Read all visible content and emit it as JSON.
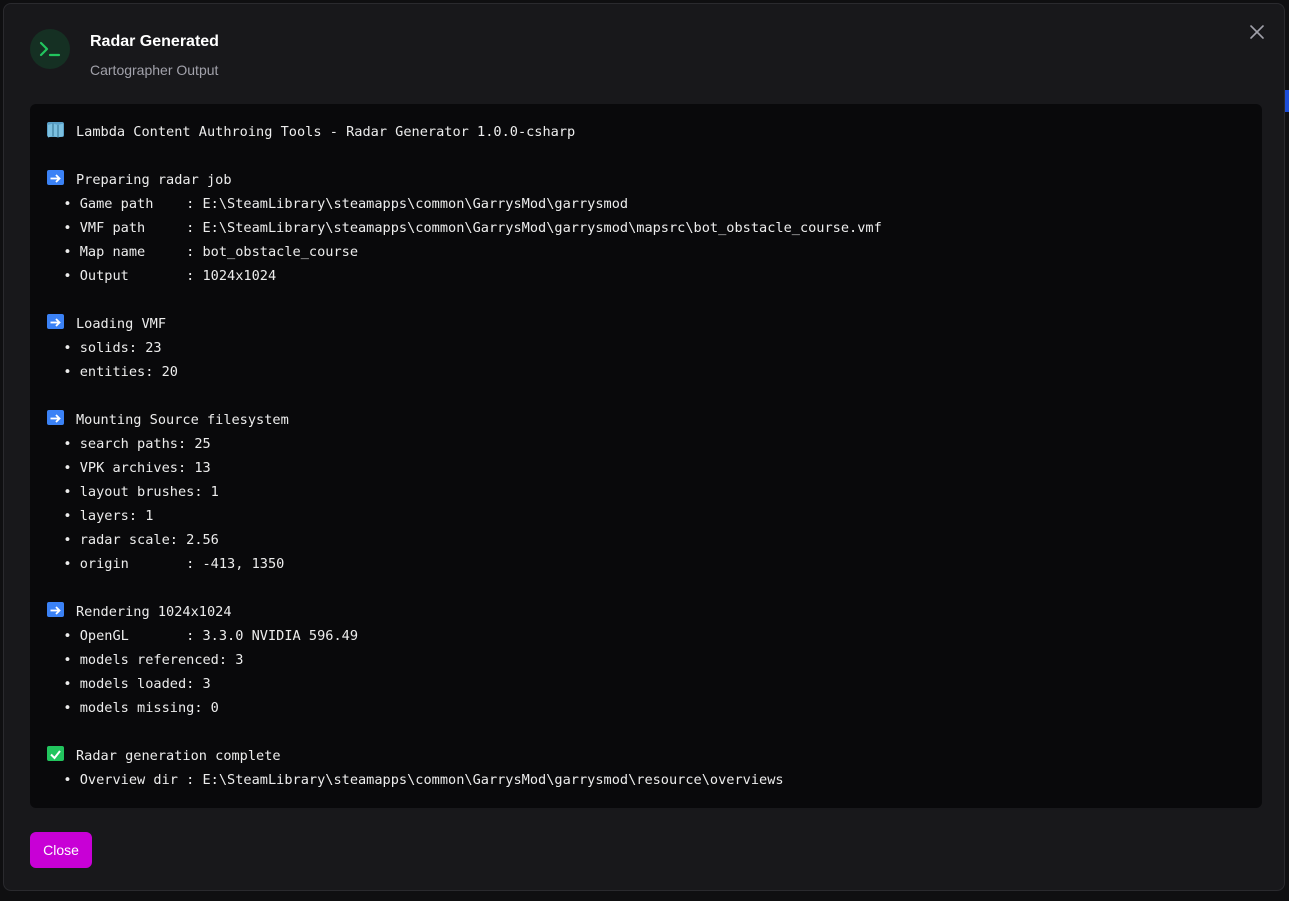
{
  "dialog": {
    "title": "Radar Generated",
    "subtitle": "Cartographer Output",
    "close_label": "Close"
  },
  "colors": {
    "accent": "#c800d6",
    "icon_bg": "#153023",
    "icon_fg": "#22c55e",
    "terminal_bg": "#09090b"
  },
  "output": {
    "lines": [
      {
        "icon": "map-icon",
        "text": "Lambda Content Authroing Tools - Radar Generator 1.0.0-csharp"
      },
      {
        "icon": "",
        "text": ""
      },
      {
        "icon": "arrow-right-icon",
        "text": "Preparing radar job"
      },
      {
        "icon": "",
        "text": "  • Game path    : E:\\SteamLibrary\\steamapps\\common\\GarrysMod\\garrysmod"
      },
      {
        "icon": "",
        "text": "  • VMF path     : E:\\SteamLibrary\\steamapps\\common\\GarrysMod\\garrysmod\\mapsrc\\bot_obstacle_course.vmf"
      },
      {
        "icon": "",
        "text": "  • Map name     : bot_obstacle_course"
      },
      {
        "icon": "",
        "text": "  • Output       : 1024x1024"
      },
      {
        "icon": "",
        "text": ""
      },
      {
        "icon": "arrow-right-icon",
        "text": "Loading VMF"
      },
      {
        "icon": "",
        "text": "  • solids: 23"
      },
      {
        "icon": "",
        "text": "  • entities: 20"
      },
      {
        "icon": "",
        "text": ""
      },
      {
        "icon": "arrow-right-icon",
        "text": "Mounting Source filesystem"
      },
      {
        "icon": "",
        "text": "  • search paths: 25"
      },
      {
        "icon": "",
        "text": "  • VPK archives: 13"
      },
      {
        "icon": "",
        "text": "  • layout brushes: 1"
      },
      {
        "icon": "",
        "text": "  • layers: 1"
      },
      {
        "icon": "",
        "text": "  • radar scale: 2.56"
      },
      {
        "icon": "",
        "text": "  • origin       : -413, 1350"
      },
      {
        "icon": "",
        "text": ""
      },
      {
        "icon": "arrow-right-icon",
        "text": "Rendering 1024x1024"
      },
      {
        "icon": "",
        "text": "  • OpenGL       : 3.3.0 NVIDIA 596.49"
      },
      {
        "icon": "",
        "text": "  • models referenced: 3"
      },
      {
        "icon": "",
        "text": "  • models loaded: 3"
      },
      {
        "icon": "",
        "text": "  • models missing: 0"
      },
      {
        "icon": "",
        "text": ""
      },
      {
        "icon": "check-icon",
        "text": "Radar generation complete"
      },
      {
        "icon": "",
        "text": "  • Overview dir : E:\\SteamLibrary\\steamapps\\common\\GarrysMod\\garrysmod\\resource\\overviews"
      }
    ]
  }
}
